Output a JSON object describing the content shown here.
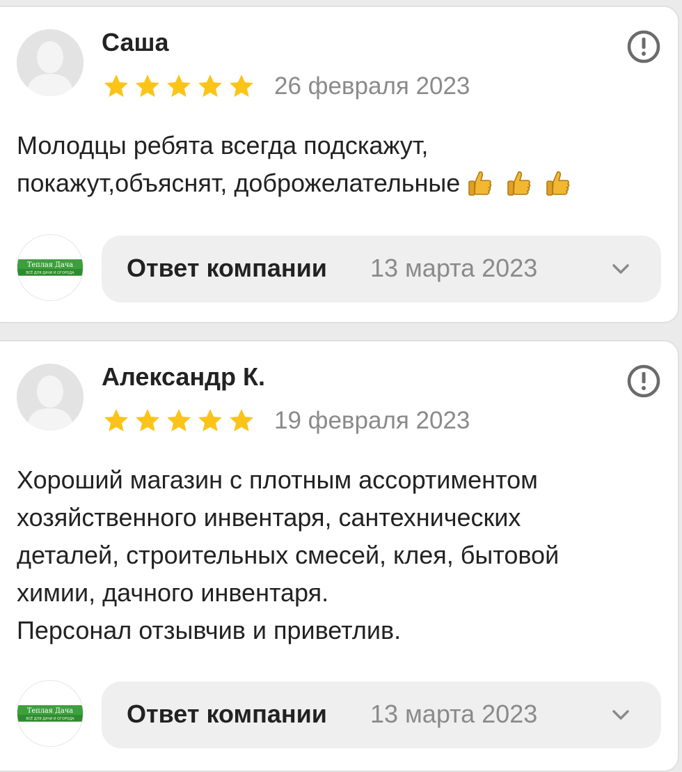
{
  "colors": {
    "star": "#fcc419",
    "muted_text": "#8a8a8a",
    "logo_green": "#2e8b2e",
    "warn_icon": "#6b6b6b"
  },
  "reviews": [
    {
      "author": "Саша",
      "rating": 5,
      "date": "26 февраля 2023",
      "text_lines": [
        "Молодцы ребята всегда подскажут,",
        "покажут,объяснят, доброжелательные"
      ],
      "emoji": [
        "thumbs-up",
        "thumbs-up",
        "thumbs-up"
      ],
      "reply": {
        "label": "Ответ компании",
        "date": "13 марта 2023"
      }
    },
    {
      "author": "Александр К.",
      "rating": 5,
      "date": "19 февраля 2023",
      "text_lines": [
        "Хороший магазин с плотным ассортиментом",
        "хозяйственного инвентаря, сантехнических",
        "деталей, строительных смесей, клея, бытовой",
        "химии, дачного инвентаря.",
        "Персонал отзывчив и приветлив."
      ],
      "reply": {
        "label": "Ответ компании",
        "date": "13 марта 2023"
      }
    }
  ],
  "company_logo": {
    "title": "Теплая Дача",
    "subtitle": "ВСЁ ДЛЯ ДАЧИ И ОГОРОДА"
  }
}
